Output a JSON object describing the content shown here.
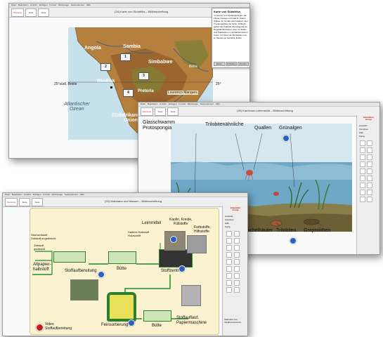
{
  "common": {
    "menu": [
      "Datei",
      "Bearbeiten",
      "Ansicht",
      "Einfügen",
      "Format",
      "Werkzeuge",
      "Seitenelement",
      "Hilfe"
    ],
    "btn_main": "Startseite",
    "btn_top": "Seite zurück",
    "btn_seq": "Seite vorwärts"
  },
  "win1": {
    "title": "(24) Karte von Südafrika – Bildbeschriftung",
    "map_labels": {
      "angola": "Angola",
      "sambia": "Sambia",
      "simbabwe": "Simbabwe",
      "windhuk": "Windhuk",
      "pretoria": "Pretoria",
      "lourenco": "Lourenco Marques",
      "atlantic": "Atlantischer\nOzean",
      "union": "Südafrikanische\nUnion",
      "beira": "Beira",
      "latitude_left": "25°südl. Breite",
      "latitude_right": "25°"
    },
    "numbers": [
      "1",
      "2",
      "3",
      "4"
    ],
    "panel_title": "Karte von Südafrika",
    "panel_text": "Im Herzen von Südafrika liegen die Flüsse Orange und Vaal im Süden Afrikas. Im Norden die Kalahari, eine Trockengebiete der Erde. Politisch gehört die Kalahari überwiegend zur Republik Botswana, aber im Süden und Südwesten zu Südafrikanischen Union. Im Osten an Simbabwe und im Westen an Namibia. Erden.",
    "panel_buttons": [
      "Weiter",
      "Schließen",
      "Drucken"
    ]
  },
  "win2": {
    "title": "(35) Kambrium Lebensbild – Bildbeschriftung",
    "labels": {
      "glasschwamm": "Glasschwamm\nProtospongia",
      "trilobiten_aehnliche": "Trilobitenähnliche",
      "quallen": "Quallen",
      "gruenalgen": "Grünalgen",
      "stachelhaeuter": "Stachelhäuter",
      "trilobiten": "Trilobiten",
      "graptolithen": "Graptolithen"
    },
    "logo": "Education\nGroup",
    "side_options": [
      "Auswahl",
      "Vorschau",
      "Hilfe",
      "Fertig"
    ]
  },
  "win3": {
    "title": "(33) Makulatur und Wasser – Bildbeschriftung",
    "labels": {
      "leimmittel": "Leimmittel",
      "kaolin": "Kaolin, Kreide,\nFüllstoffe",
      "farbstoffe": "Farbstoffe,\nHilfsstoffe",
      "hadern": "Hadern-Halbstoff\nHolzschliff",
      "strohzellstoff": "Strohzellstoff\nZellstoff ungebleicht",
      "zellstoff_gebleicht": "Zellstoff\ngebleicht",
      "altpapier": "Altpapier-\nhalbstoff",
      "stoffaufbereitung": "Stoffaufbereitung",
      "buette1": "Bütte",
      "stoffzentrale": "Stoffzentrale",
      "feinsortierung": "Feinsortierung",
      "buette2": "Bütte",
      "stoffauflauf": "Stoffauflauf,\nPapiermaschine",
      "video": "Video\nStoffaufbereitung"
    },
    "logo": "Education\nGroup",
    "side_options": [
      "Auswahl",
      "Vorschau",
      "Hilfe",
      "Fertig"
    ],
    "footer": "Startseite zum\nInhaltsverzeichnis"
  },
  "colors": {
    "map_land": "#b5803e",
    "ocean": "#c7e1ec",
    "flow_line": "#1f8a2c",
    "info": "#2c5fbf",
    "video": "#c71c1c"
  }
}
